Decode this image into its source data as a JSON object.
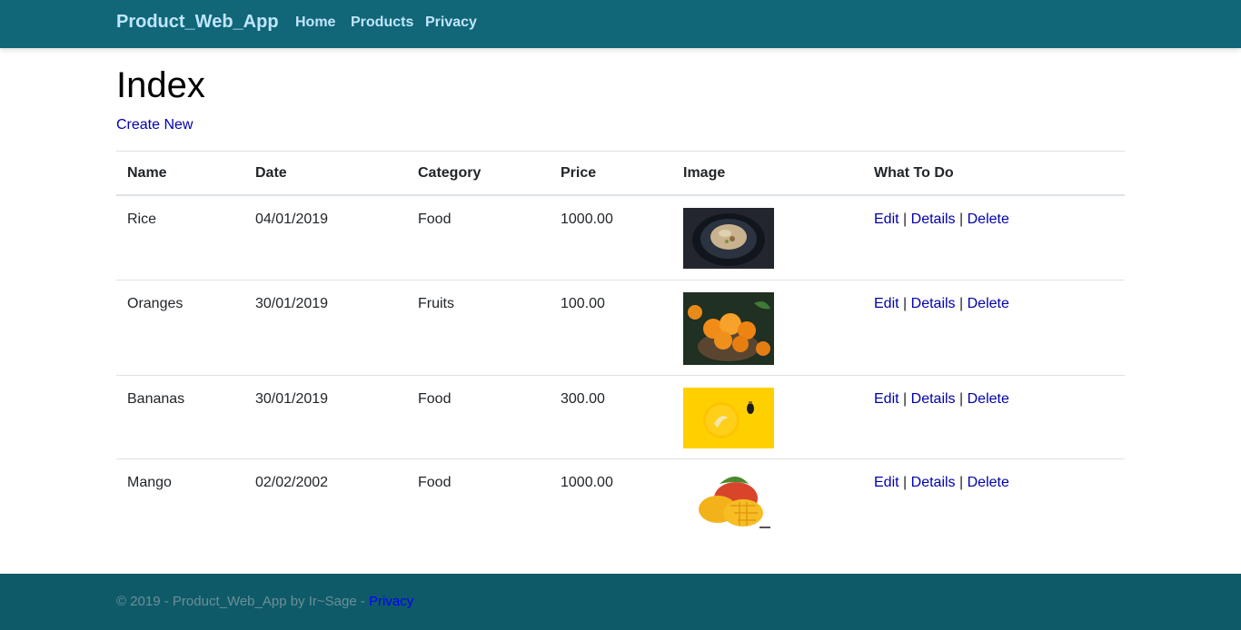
{
  "navbar": {
    "brand": "Product_Web_App",
    "links": [
      "Home",
      "Products",
      "Privacy"
    ]
  },
  "page": {
    "title": "Index",
    "create_link": "Create New"
  },
  "table": {
    "headers": [
      "Name",
      "Date",
      "Category",
      "Price",
      "Image",
      "What To Do"
    ],
    "rows": [
      {
        "name": "Rice",
        "date": "04/01/2019",
        "category": "Food",
        "price": "1000.00",
        "image": "rice-photo"
      },
      {
        "name": "Oranges",
        "date": "30/01/2019",
        "category": "Fruits",
        "price": "100.00",
        "image": "oranges-photo"
      },
      {
        "name": "Bananas",
        "date": "30/01/2019",
        "category": "Food",
        "price": "300.00",
        "image": "bananas-photo"
      },
      {
        "name": "Mango",
        "date": "02/02/2002",
        "category": "Food",
        "price": "1000.00",
        "image": "mango-photo"
      }
    ],
    "actions": {
      "edit": "Edit",
      "details": "Details",
      "delete": "Delete",
      "separator": "|"
    }
  },
  "footer": {
    "text": "© 2019 - Product_Web_App by Ir~Sage - ",
    "privacy_link": "Privacy"
  },
  "colors": {
    "navbar": "#116677",
    "nav_text": "#bfe6ff",
    "footer": "#0f5a68",
    "link": "#0000aa"
  }
}
